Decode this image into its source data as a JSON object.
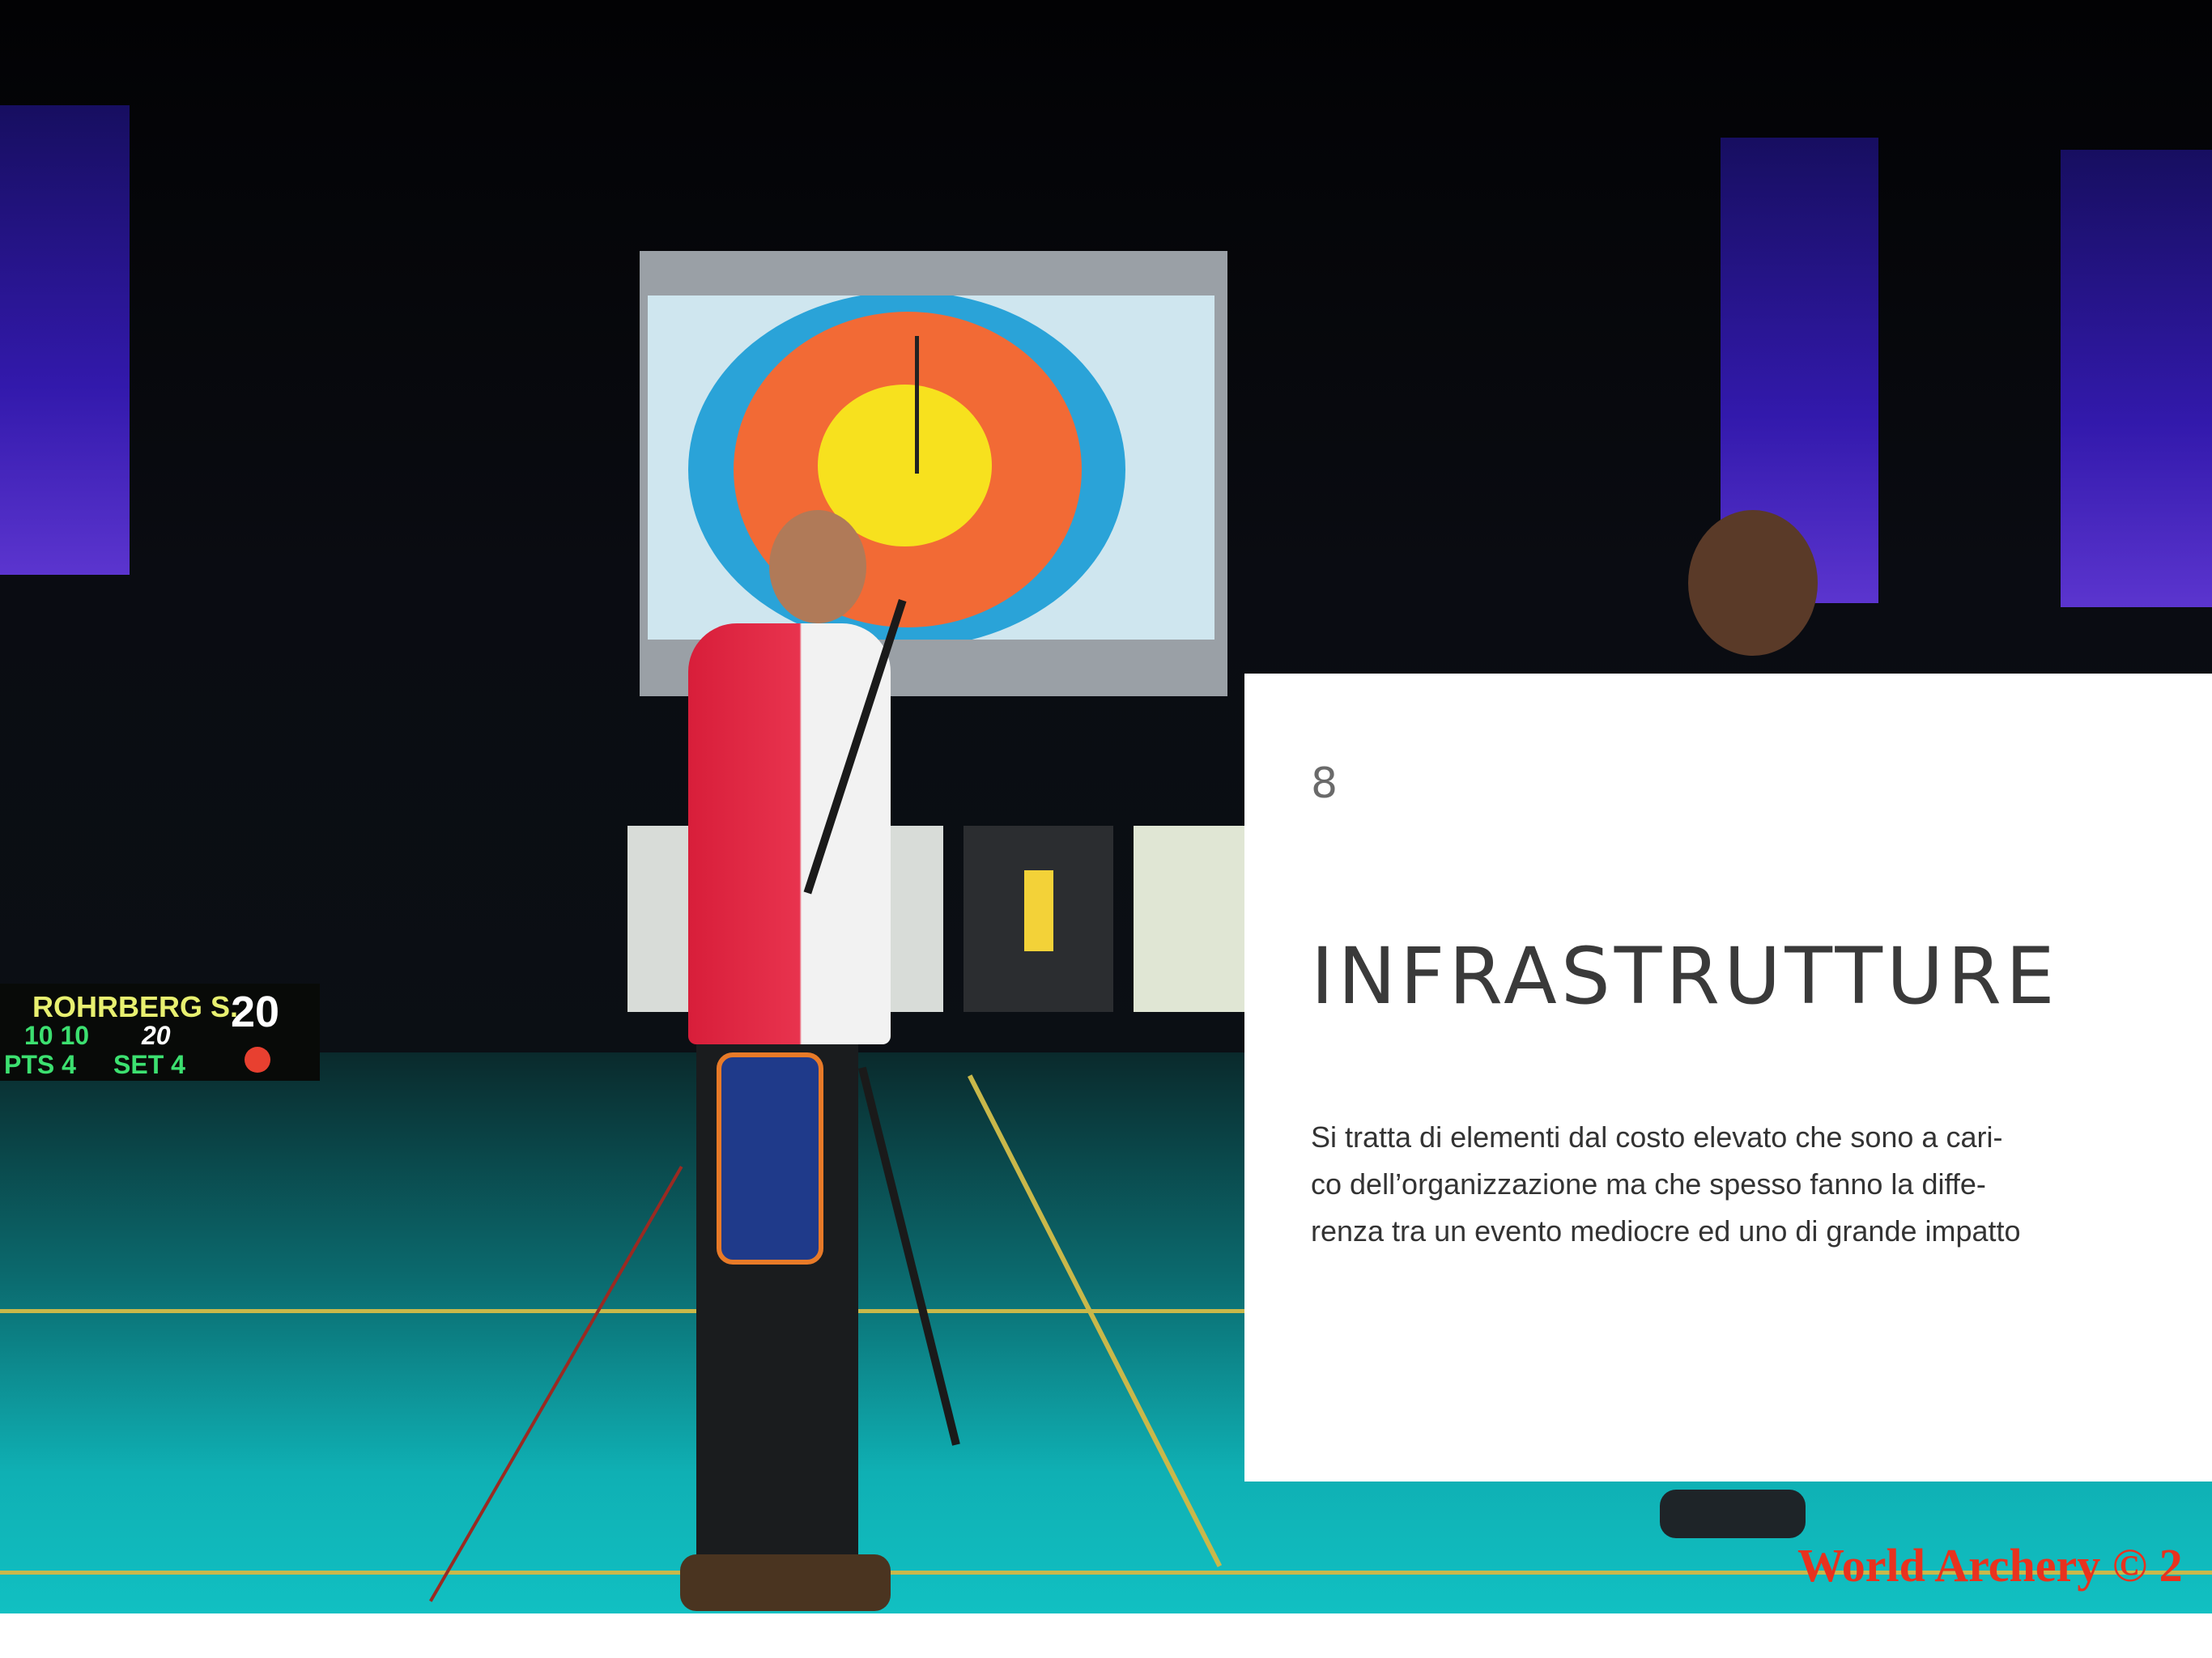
{
  "page": {
    "number": "8",
    "title": "INFRASTRUTTURE",
    "body_lines": [
      "Si tratta di elementi dal costo elevato che sono a cari-",
      "co dell’organizzazione ma che spesso fanno la diffe-",
      "renza tra un evento mediocre ed uno di grande impatto"
    ]
  },
  "photo": {
    "scoreboard": {
      "name": "ROHRBERG S.",
      "score": "20",
      "row2_left": "10 10",
      "row2_right": "20",
      "row3_left": "PTS 4",
      "row3_right": "SET 4"
    },
    "watermark": "World Archery © 2"
  }
}
